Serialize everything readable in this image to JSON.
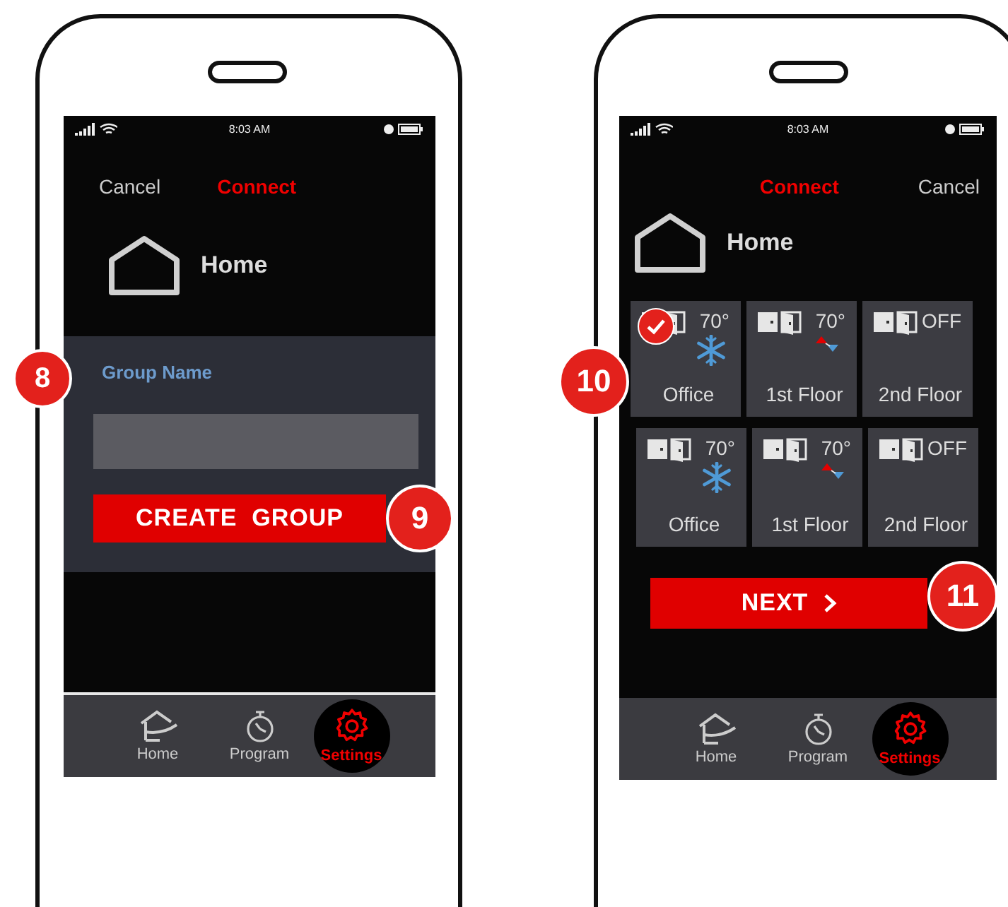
{
  "phones": [
    {
      "kind": "group",
      "status_bar": {
        "time": "8:03 AM"
      },
      "header": [
        {
          "kind": "cancel",
          "label": "Cancel"
        },
        {
          "kind": "connect",
          "label": "Connect"
        }
      ],
      "home_label": "Home",
      "group_form": {
        "label": "Group Name",
        "callout": "8",
        "button": "CREATE  GROUP",
        "button_callout": "9"
      },
      "tabs": [
        {
          "kind": "home",
          "label": "Home",
          "selected": false
        },
        {
          "kind": "program",
          "label": "Program",
          "selected": false
        },
        {
          "kind": "settings",
          "label": "Settings",
          "selected": true
        }
      ]
    },
    {
      "kind": "zones",
      "status_bar": {
        "time": "8:03 AM"
      },
      "header": [
        {
          "kind": "connect",
          "label": "Connect"
        },
        {
          "kind": "cancel",
          "label": "Cancel"
        }
      ],
      "home_label": "Home",
      "zones_callout": "10",
      "zones": [
        {
          "name": "Office",
          "reading": "70°",
          "kind": "cool",
          "selected": true
        },
        {
          "name": "1st Floor",
          "reading": "70°",
          "kind": "auto",
          "selected": false
        },
        {
          "name": "2nd Floor",
          "reading": "OFF",
          "kind": "off",
          "selected": false
        },
        {
          "name": "Office",
          "reading": "70°",
          "kind": "cool",
          "selected": false
        },
        {
          "name": "1st Floor",
          "reading": "70°",
          "kind": "auto",
          "selected": false
        },
        {
          "name": "2nd Floor",
          "reading": "OFF",
          "kind": "off",
          "selected": false
        }
      ],
      "next_button": "NEXT",
      "next_callout": "11",
      "tabs": [
        {
          "kind": "home",
          "label": "Home",
          "selected": false
        },
        {
          "kind": "program",
          "label": "Program",
          "selected": false
        },
        {
          "kind": "settings",
          "label": "Settings",
          "selected": true
        }
      ]
    }
  ]
}
